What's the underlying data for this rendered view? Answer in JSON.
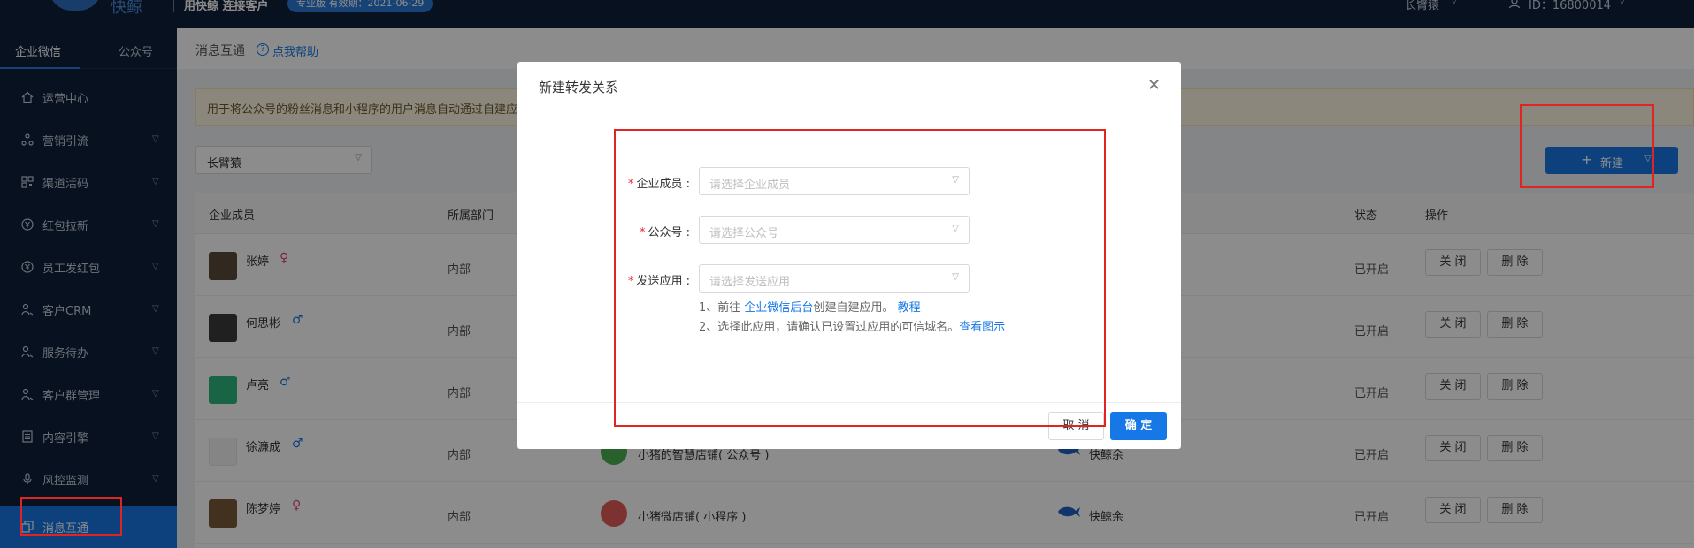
{
  "topbar": {
    "brand": "快鲸",
    "slogan": "用快鲸 连接客户",
    "version_badge": "专业版 有效期：2021-06-29",
    "account": "长臂猿",
    "user_id": "ID：16800014"
  },
  "sidebar": {
    "tabs": [
      {
        "label": "企业微信",
        "active": true
      },
      {
        "label": "公众号",
        "active": false
      }
    ],
    "items": [
      {
        "label": "运营中心",
        "icon": "home-icon",
        "has_children": false
      },
      {
        "label": "营销引流",
        "icon": "funnel-icon",
        "has_children": true
      },
      {
        "label": "渠道活码",
        "icon": "qrcode-icon",
        "has_children": true
      },
      {
        "label": "红包拉新",
        "icon": "yen-coin-icon",
        "has_children": true
      },
      {
        "label": "员工发红包",
        "icon": "yen-coin-icon",
        "has_children": true
      },
      {
        "label": "客户CRM",
        "icon": "users-icon",
        "has_children": true
      },
      {
        "label": "服务待办",
        "icon": "users-icon",
        "has_children": true
      },
      {
        "label": "客户群管理",
        "icon": "users-icon",
        "has_children": true
      },
      {
        "label": "内容引擎",
        "icon": "document-icon",
        "has_children": true
      },
      {
        "label": "风控监测",
        "icon": "microphone-icon",
        "has_children": true
      },
      {
        "label": "消息互通",
        "icon": "copy-icon",
        "has_children": false,
        "active": true
      }
    ]
  },
  "page": {
    "title": "消息互通",
    "help_link": "点我帮助",
    "notice": "用于将公众号的粉丝消息和小程序的用户消息自动通过自建应用推送",
    "account_select": "长臂猿",
    "new_button": "新建"
  },
  "table": {
    "columns": [
      "企业成员",
      "所属部门",
      "状态",
      "操作"
    ],
    "rows": [
      {
        "name": "张婷",
        "gender": "♀",
        "gender_class": "f",
        "dept": "内部",
        "app": "",
        "app_color": "",
        "wx_app": "",
        "status": "已开启",
        "avatar_color": "#5a4a3a"
      },
      {
        "name": "何思彬",
        "gender": "♂",
        "gender_class": "m",
        "dept": "内部",
        "app": "",
        "app_color": "",
        "wx_app": "",
        "status": "已开启",
        "avatar_color": "#3b3b3b"
      },
      {
        "name": "卢亮",
        "gender": "♂",
        "gender_class": "m",
        "dept": "内部",
        "app": "",
        "app_color": "",
        "wx_app": "",
        "status": "已开启",
        "avatar_color": "#2cb67d"
      },
      {
        "name": "徐濂成",
        "gender": "♂",
        "gender_class": "m",
        "dept": "内部",
        "app": "小猪的智慧店铺( 公众号 )",
        "app_color": "#4caf50",
        "wx_app": "快鲸余",
        "status": "已开启",
        "avatar_color": "#f2f2f2"
      },
      {
        "name": "陈梦婷",
        "gender": "♀",
        "gender_class": "f",
        "dept": "内部",
        "app": "小猪微店铺( 小程序 )",
        "app_color": "#e45b5b",
        "wx_app": "快鲸余",
        "status": "已开启",
        "avatar_color": "#7a5a3a"
      }
    ],
    "close_label": "关 闭",
    "delete_label": "删 除"
  },
  "modal": {
    "title": "新建转发关系",
    "fields": [
      {
        "label": "企业成员 :",
        "placeholder": "请选择企业成员"
      },
      {
        "label": "公众号 :",
        "placeholder": "请选择公众号"
      },
      {
        "label": "发送应用 :",
        "placeholder": "请选择发送应用"
      }
    ],
    "hint1_prefix": "1、前往",
    "hint1_link": "企业微信后台",
    "hint1_mid": "创建自建应用。",
    "hint1_tutorial": "教程",
    "hint2_text": "2、选择此应用，请确认已设置过应用的可信域名。",
    "hint2_link": "查看图示",
    "cancel_label": "取 消",
    "ok_label": "确 定"
  }
}
